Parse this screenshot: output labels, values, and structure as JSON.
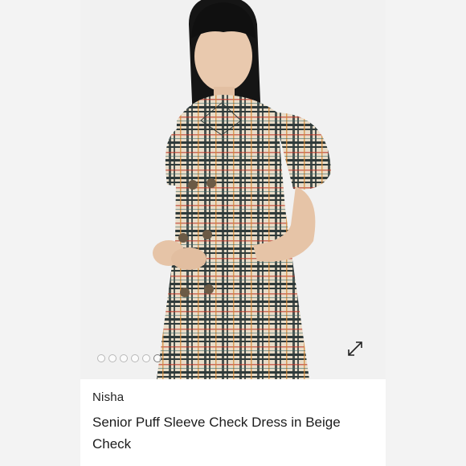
{
  "carousel": {
    "image_alt": "Child wearing a beige check puff sleeve dress",
    "slide_count": 6,
    "active_index": 5,
    "icons": {
      "expand": "expand-diagonal-arrows-icon"
    }
  },
  "product": {
    "brand": "Nisha",
    "title": "Senior Puff Sleeve Check Dress in Beige Check"
  },
  "colors": {
    "page_background": "#f3f3f3",
    "card_background": "#ffffff",
    "photo_background": "#f1f1f1",
    "text_primary": "#1c1c1c"
  }
}
